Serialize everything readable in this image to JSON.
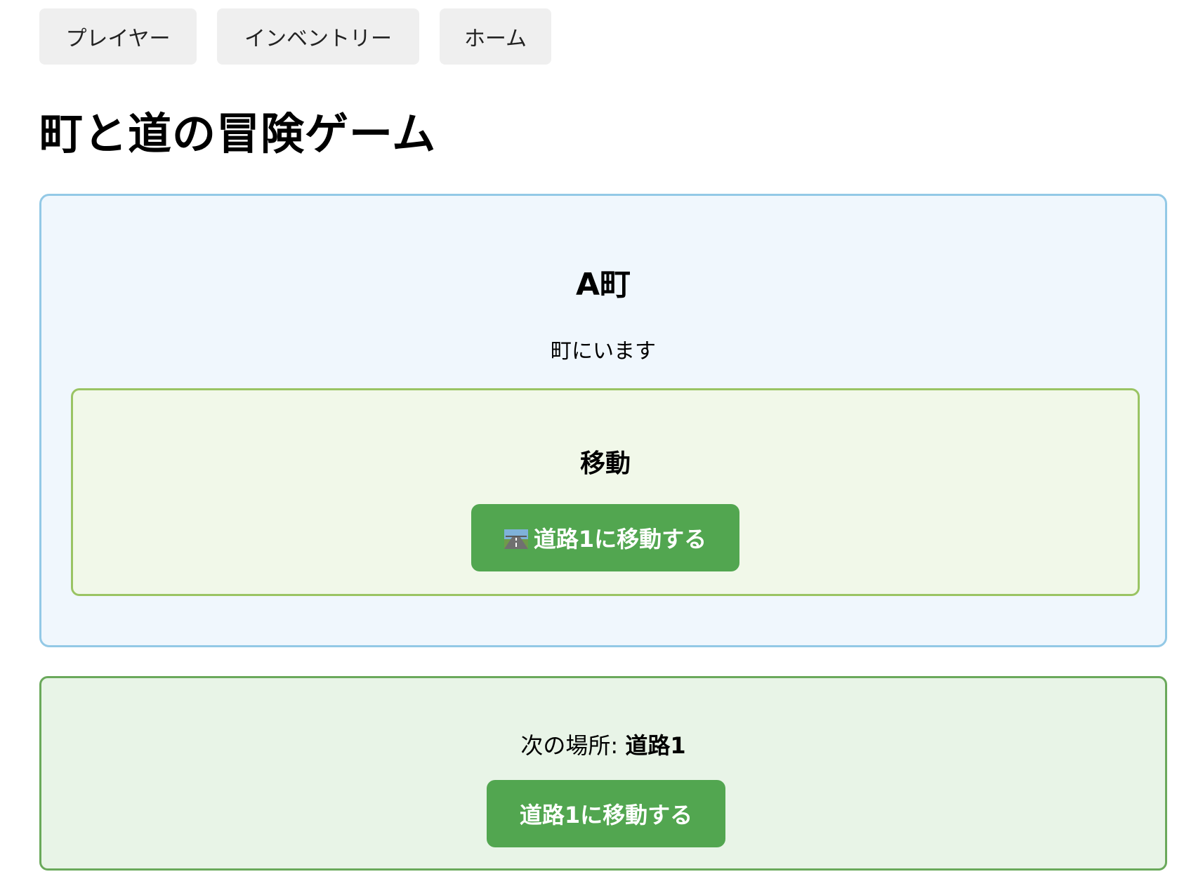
{
  "nav": {
    "player_label": "プレイヤー",
    "inventory_label": "インベントリー",
    "home_label": "ホーム"
  },
  "page": {
    "title": "町と道の冒険ゲーム"
  },
  "location": {
    "name": "A町",
    "status": "町にいます"
  },
  "move": {
    "heading": "移動",
    "button_label": "道路1に移動する",
    "button_icon": "motorway-icon"
  },
  "next": {
    "prefix": "次の場所: ",
    "value": "道路1",
    "button_label": "道路1に移動する"
  },
  "colors": {
    "location_bg": "#f0f7fd",
    "location_border": "#93c9e6",
    "move_bg": "#f1f8e9",
    "move_border": "#9ac463",
    "next_bg": "#e8f4e7",
    "next_border": "#6aa95b",
    "button_green": "#52a650",
    "nav_bg": "#efefef"
  }
}
